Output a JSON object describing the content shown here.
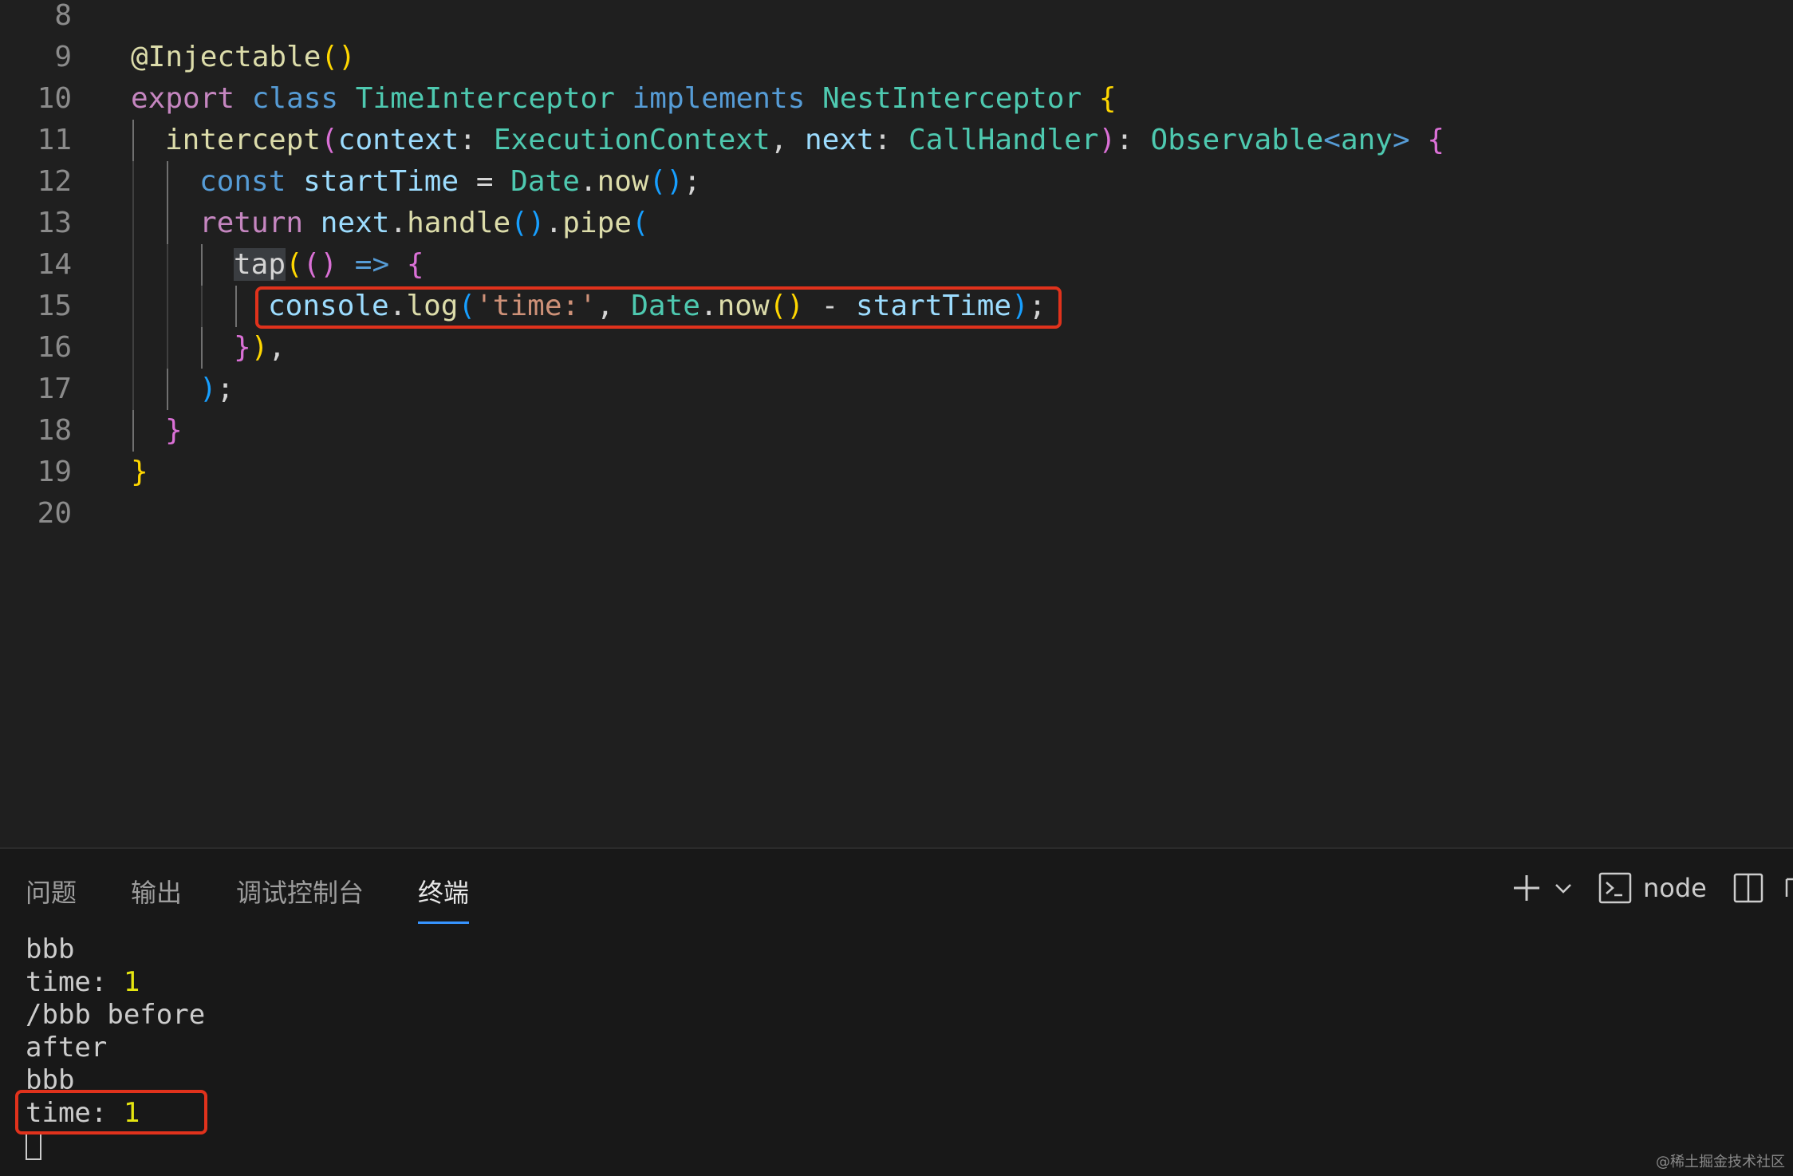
{
  "editor": {
    "lines": [
      {
        "num": "8",
        "indent": 0,
        "tokens": []
      },
      {
        "num": "9",
        "indent": 0,
        "tokens": [
          [
            "@Injectable",
            "func"
          ],
          [
            "()",
            "b1"
          ]
        ]
      },
      {
        "num": "10",
        "indent": 0,
        "tokens": [
          [
            "export",
            "keyword"
          ],
          [
            " ",
            "plain"
          ],
          [
            "class",
            "storage"
          ],
          [
            " ",
            "plain"
          ],
          [
            "TimeInterceptor",
            "type"
          ],
          [
            " ",
            "plain"
          ],
          [
            "implements",
            "storage"
          ],
          [
            " ",
            "plain"
          ],
          [
            "NestInterceptor",
            "type"
          ],
          [
            " ",
            "plain"
          ],
          [
            "{",
            "b1"
          ]
        ]
      },
      {
        "num": "11",
        "indent": 1,
        "tokens": [
          [
            "intercept",
            "func"
          ],
          [
            "(",
            "b2"
          ],
          [
            "context",
            "var"
          ],
          [
            ": ",
            "plain"
          ],
          [
            "ExecutionContext",
            "type"
          ],
          [
            ", ",
            "plain"
          ],
          [
            "next",
            "var"
          ],
          [
            ": ",
            "plain"
          ],
          [
            "CallHandler",
            "type"
          ],
          [
            ")",
            "b2"
          ],
          [
            ": ",
            "plain"
          ],
          [
            "Observable",
            "type"
          ],
          [
            "<",
            "storage"
          ],
          [
            "any",
            "type"
          ],
          [
            "> ",
            "storage"
          ],
          [
            "{",
            "b2"
          ]
        ]
      },
      {
        "num": "12",
        "indent": 2,
        "tokens": [
          [
            "const",
            "storage"
          ],
          [
            " ",
            "plain"
          ],
          [
            "startTime",
            "var"
          ],
          [
            " = ",
            "plain"
          ],
          [
            "Date",
            "type"
          ],
          [
            ".",
            "plain"
          ],
          [
            "now",
            "func"
          ],
          [
            "()",
            "b3"
          ],
          [
            ";",
            "plain"
          ]
        ]
      },
      {
        "num": "13",
        "indent": 2,
        "tokens": [
          [
            "return",
            "keyword"
          ],
          [
            " ",
            "plain"
          ],
          [
            "next",
            "var"
          ],
          [
            ".",
            "plain"
          ],
          [
            "handle",
            "func"
          ],
          [
            "()",
            "b3"
          ],
          [
            ".",
            "plain"
          ],
          [
            "pipe",
            "func"
          ],
          [
            "(",
            "b3"
          ]
        ]
      },
      {
        "num": "14",
        "indent": 3,
        "tokens": [
          [
            "tap",
            "hl"
          ],
          [
            "(",
            "b1"
          ],
          [
            "()",
            "b2"
          ],
          [
            " ",
            "plain"
          ],
          [
            "=>",
            "storage"
          ],
          [
            " ",
            "plain"
          ],
          [
            "{",
            "b2"
          ]
        ]
      },
      {
        "num": "15",
        "indent": 4,
        "tokens": [
          [
            "console",
            "var"
          ],
          [
            ".",
            "plain"
          ],
          [
            "log",
            "func"
          ],
          [
            "(",
            "b3"
          ],
          [
            "'time:'",
            "string"
          ],
          [
            ", ",
            "plain"
          ],
          [
            "Date",
            "type"
          ],
          [
            ".",
            "plain"
          ],
          [
            "now",
            "func"
          ],
          [
            "()",
            "b1"
          ],
          [
            " - ",
            "plain"
          ],
          [
            "startTime",
            "var"
          ],
          [
            ")",
            "b3"
          ],
          [
            ";",
            "plain"
          ]
        ]
      },
      {
        "num": "16",
        "indent": 3,
        "tokens": [
          [
            "}",
            "b2"
          ],
          [
            ")",
            "b1"
          ],
          [
            ",",
            "plain"
          ]
        ]
      },
      {
        "num": "17",
        "indent": 2,
        "tokens": [
          [
            ")",
            "b3"
          ],
          [
            ";",
            "plain"
          ]
        ]
      },
      {
        "num": "18",
        "indent": 1,
        "tokens": [
          [
            "}",
            "b2"
          ]
        ]
      },
      {
        "num": "19",
        "indent": 0,
        "tokens": [
          [
            "}",
            "b1"
          ]
        ]
      },
      {
        "num": "20",
        "indent": 0,
        "tokens": []
      }
    ]
  },
  "panel": {
    "tabs": [
      {
        "label": "问题",
        "active": false
      },
      {
        "label": "输出",
        "active": false
      },
      {
        "label": "调试控制台",
        "active": false
      },
      {
        "label": "终端",
        "active": true
      }
    ],
    "terminal_name": "node",
    "terminal_lines": [
      {
        "text": "bbb",
        "num": ""
      },
      {
        "text": "time: ",
        "num": "1"
      },
      {
        "text": "/bbb before",
        "num": ""
      },
      {
        "text": "after",
        "num": ""
      },
      {
        "text": "bbb",
        "num": ""
      },
      {
        "text": "time: ",
        "num": "1"
      }
    ]
  },
  "watermark": "@稀土掘金技术社区"
}
